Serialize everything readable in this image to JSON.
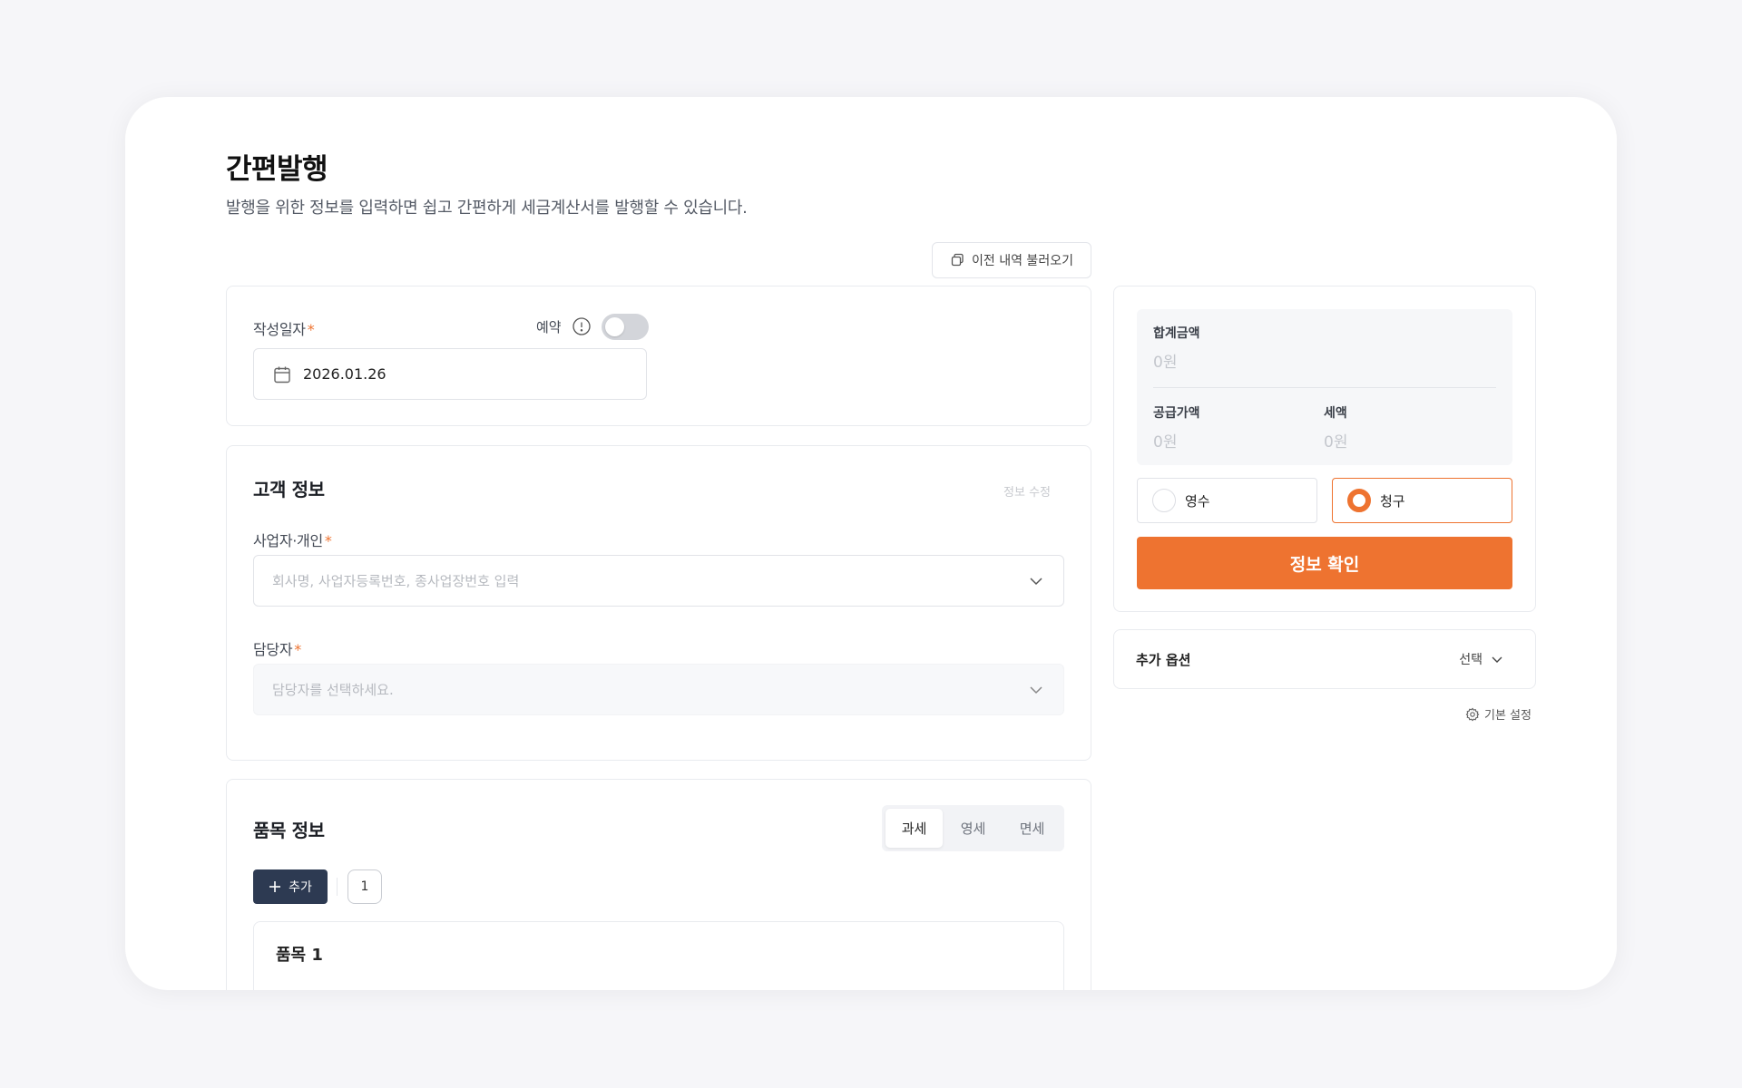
{
  "header": {
    "title": "간편발행",
    "subtitle": "발행을 위한 정보를 입력하면 쉽고 간편하게 세금계산서를 발행할 수 있습니다."
  },
  "toolbar": {
    "load_previous_label": "이전 내역 불러오기",
    "load_previous_icon": "copy-icon"
  },
  "date_section": {
    "label": "작성일자",
    "required_mark": "*",
    "reservation_label": "예약",
    "reservation_enabled": false,
    "date_value": "2026.01.26"
  },
  "customer_section": {
    "title": "고객 정보",
    "edit_label": "정보 수정",
    "business_label": "사업자·개인",
    "business_placeholder": "회사명, 사업자등록번호, 종사업장번호 입력",
    "contact_label": "담당자",
    "contact_placeholder": "담당자를 선택하세요."
  },
  "items_section": {
    "title": "품목 정보",
    "tax_types": [
      "과세",
      "영세",
      "면세"
    ],
    "selected_tax_type": "과세",
    "add_label": "추가",
    "item_count": "1",
    "first_item_title": "품목 1"
  },
  "summary": {
    "total_label": "합계금액",
    "total_value": "0원",
    "supply_label": "공급가액",
    "supply_value": "0원",
    "tax_label": "세액",
    "tax_value": "0원",
    "receipt_label": "영수",
    "claim_label": "청구",
    "selected_type": "청구",
    "confirm_label": "정보 확인"
  },
  "options": {
    "title": "추가 옵션",
    "select_label": "선택",
    "settings_label": "기본 설정"
  },
  "colors": {
    "accent": "#ee7330",
    "dark_button": "#2d3a52",
    "background": "#f6f6f9"
  }
}
